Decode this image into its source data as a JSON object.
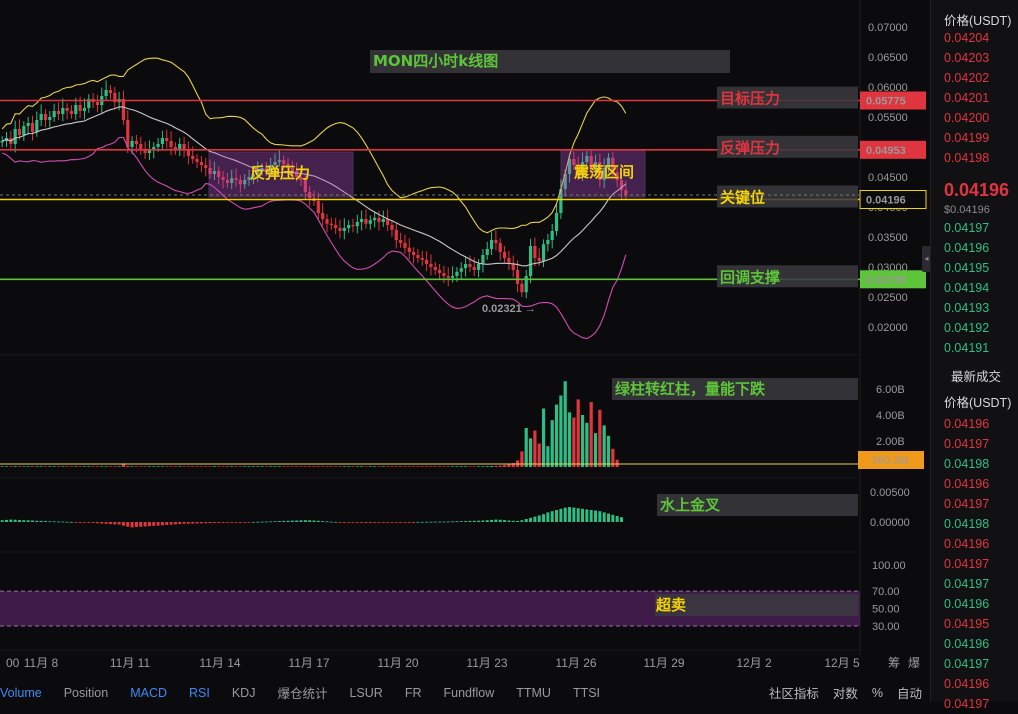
{
  "title": "MON四小时k线图",
  "price_axis": {
    "ticks": [
      "0.07000",
      "0.06500",
      "0.06000",
      "0.05500",
      "0.05000",
      "0.04500",
      "0.04000",
      "0.03500",
      "0.03000",
      "0.02500",
      "0.02000"
    ]
  },
  "volume_axis": {
    "ticks": [
      "6.00B",
      "4.00B",
      "2.00B"
    ],
    "current": "560.3M"
  },
  "macd_axis": {
    "ticks": [
      "0.00500",
      "0.00000"
    ]
  },
  "rsi_axis": {
    "ticks": [
      "100.00",
      "70.00",
      "50.00",
      "30.00"
    ]
  },
  "dates": [
    "00",
    "11月 8",
    "11月 11",
    "11月 14",
    "11月 17",
    "11月 20",
    "11月 23",
    "11月 26",
    "11月 29",
    "12月 2",
    "12月 5"
  ],
  "date_axis_icons": [
    "筹",
    "爆"
  ],
  "levels": [
    {
      "label": "目标压力",
      "price_tag": "0.05775",
      "price": 0.05775,
      "color": "#e0343f"
    },
    {
      "label": "反弹压力",
      "price_tag": "0.04953",
      "price": 0.04953,
      "color": "#e0343f"
    },
    {
      "label": "关键位",
      "price_tag": "0.04196",
      "price": 0.04125,
      "color": "#f5d300"
    },
    {
      "label": "回调支撑",
      "price_tag": "0.02795",
      "price": 0.02795,
      "color": "#5ec43a"
    }
  ],
  "boxes": [
    {
      "label": "反弹压力"
    },
    {
      "label": "震荡区间"
    }
  ],
  "low_marker": "0.02321",
  "volume_note": "绿柱转红柱，量能下跌",
  "macd_note": "水上金叉",
  "rsi_note": "超卖",
  "orderbook": {
    "header": "价格(USDT)",
    "asks": [
      "0.04204",
      "0.04203",
      "0.04202",
      "0.04201",
      "0.04200",
      "0.04199",
      "0.04198"
    ],
    "last_price": "0.04196",
    "mark_price": "$0.04196",
    "bids": [
      "0.04197",
      "0.04196",
      "0.04195",
      "0.04194",
      "0.04193",
      "0.04192",
      "0.04191"
    ],
    "trades_title": "最新成交",
    "trades_header": "价格(USDT)",
    "trades": [
      {
        "p": "0.04196",
        "side": "sell"
      },
      {
        "p": "0.04197",
        "side": "sell"
      },
      {
        "p": "0.04198",
        "side": "buy"
      },
      {
        "p": "0.04196",
        "side": "sell"
      },
      {
        "p": "0.04197",
        "side": "sell"
      },
      {
        "p": "0.04198",
        "side": "buy"
      },
      {
        "p": "0.04196",
        "side": "sell"
      },
      {
        "p": "0.04197",
        "side": "sell"
      },
      {
        "p": "0.04197",
        "side": "buy"
      },
      {
        "p": "0.04196",
        "side": "buy"
      },
      {
        "p": "0.04195",
        "side": "sell"
      },
      {
        "p": "0.04196",
        "side": "buy"
      },
      {
        "p": "0.04197",
        "side": "buy"
      },
      {
        "p": "0.04196",
        "side": "sell"
      },
      {
        "p": "0.04197",
        "side": "sell"
      }
    ]
  },
  "bottom_tabs": [
    "Volume",
    "Position",
    "MACD",
    "RSI",
    "KDJ",
    "爆仓统计",
    "LSUR",
    "FR",
    "Fundflow",
    "TTMU",
    "TTSI"
  ],
  "bottom_tabs_active": [
    "Volume",
    "MACD",
    "RSI"
  ],
  "bottom_right": [
    "社区指标",
    "对数",
    "%",
    "自动"
  ],
  "chart_data": {
    "type": "candlestick",
    "title": "MON四小时k线图",
    "x_range": [
      "11月 8",
      "11月 27"
    ],
    "y_range": [
      0.0175,
      0.0725
    ],
    "last": 0.04196,
    "low": 0.02321,
    "closes": [
      0.051,
      0.0515,
      0.0505,
      0.053,
      0.052,
      0.0535,
      0.054,
      0.0525,
      0.0545,
      0.0555,
      0.0545,
      0.055,
      0.056,
      0.0555,
      0.0565,
      0.056,
      0.0555,
      0.057,
      0.056,
      0.0565,
      0.058,
      0.0575,
      0.057,
      0.0585,
      0.0595,
      0.059,
      0.0575,
      0.058,
      0.0545,
      0.05,
      0.051,
      0.0505,
      0.0495,
      0.049,
      0.0495,
      0.05,
      0.0505,
      0.0515,
      0.051,
      0.05,
      0.0495,
      0.0505,
      0.0495,
      0.0485,
      0.048,
      0.0475,
      0.047,
      0.0465,
      0.0455,
      0.046,
      0.045,
      0.0445,
      0.044,
      0.0448,
      0.0445,
      0.0438,
      0.0445,
      0.045,
      0.0455,
      0.046,
      0.0465,
      0.0462,
      0.047,
      0.0475,
      0.0478,
      0.0472,
      0.0465,
      0.046,
      0.045,
      0.0445,
      0.0425,
      0.0415,
      0.041,
      0.039,
      0.038,
      0.0372,
      0.037,
      0.0365,
      0.036,
      0.0365,
      0.037,
      0.0368,
      0.0375,
      0.038,
      0.0372,
      0.0378,
      0.0382,
      0.0375,
      0.038,
      0.037,
      0.0362,
      0.0345,
      0.034,
      0.0332,
      0.0325,
      0.032,
      0.0315,
      0.0312,
      0.0305,
      0.03,
      0.0295,
      0.029,
      0.0285,
      0.0282,
      0.0285,
      0.0292,
      0.0298,
      0.0305,
      0.03,
      0.0295,
      0.0305,
      0.032,
      0.033,
      0.0345,
      0.034,
      0.0325,
      0.0315,
      0.0305,
      0.0295,
      0.0272,
      0.0258,
      0.0285,
      0.0335,
      0.0315,
      0.031,
      0.0338,
      0.0345,
      0.036,
      0.039,
      0.043,
      0.0455,
      0.048,
      0.047,
      0.0455,
      0.0475,
      0.0485,
      0.0462,
      0.0475,
      0.0445,
      0.0465,
      0.0482,
      0.0458,
      0.0445,
      0.0428,
      0.042
    ],
    "volume_series_B": [
      0.05,
      0.05,
      0.05,
      0.06,
      0.05,
      0.05,
      0.05,
      0.06,
      0.05,
      0.05,
      0.05,
      0.05,
      0.05,
      0.05,
      0.05,
      0.05,
      0.05,
      0.05,
      0.05,
      0.05,
      0.05,
      0.05,
      0.05,
      0.05,
      0.05,
      0.05,
      0.05,
      0.05,
      0.28,
      0.08,
      0.05,
      0.05,
      0.05,
      0.05,
      0.05,
      0.05,
      0.05,
      0.05,
      0.05,
      0.05,
      0.05,
      0.05,
      0.05,
      0.05,
      0.05,
      0.05,
      0.05,
      0.05,
      0.05,
      0.05,
      0.05,
      0.05,
      0.05,
      0.05,
      0.05,
      0.05,
      0.05,
      0.05,
      0.05,
      0.05,
      0.05,
      0.05,
      0.05,
      0.05,
      0.05,
      0.05,
      0.05,
      0.05,
      0.05,
      0.05,
      0.05,
      0.05,
      0.05,
      0.05,
      0.05,
      0.05,
      0.05,
      0.05,
      0.05,
      0.05,
      0.05,
      0.05,
      0.05,
      0.05,
      0.05,
      0.05,
      0.05,
      0.05,
      0.05,
      0.05,
      0.05,
      0.05,
      0.05,
      0.05,
      0.05,
      0.05,
      0.05,
      0.05,
      0.05,
      0.05,
      0.05,
      0.05,
      0.05,
      0.05,
      0.05,
      0.05,
      0.05,
      0.05,
      0.05,
      0.05,
      0.05,
      0.05,
      0.06,
      0.07,
      0.08,
      0.1,
      0.15,
      0.2,
      0.3,
      0.5,
      1.2,
      3.0,
      2.2,
      2.8,
      1.8,
      4.5,
      1.6,
      3.6,
      4.8,
      5.5,
      6.6,
      4.2,
      3.8,
      5.2,
      4.0,
      3.4,
      5.0,
      2.6,
      4.4,
      3.2,
      2.4,
      1.4,
      0.56
    ],
    "macd_hist": [
      0.0003,
      0.00035,
      0.0004,
      0.00038,
      0.00032,
      0.0003,
      0.00028,
      0.00025,
      0.0002,
      0.00018,
      0.00015,
      0.00012,
      0.0001,
      8e-05,
      6e-05,
      4e-05,
      2e-05,
      -2e-05,
      -5e-05,
      -8e-05,
      -0.00012,
      -0.00015,
      -0.0002,
      -0.00025,
      -0.0003,
      -0.00035,
      -0.0004,
      -0.00042,
      -0.0006,
      -0.0008,
      -0.0009,
      -0.00085,
      -0.0008,
      -0.00075,
      -0.0007,
      -0.00065,
      -0.0006,
      -0.00055,
      -0.0005,
      -0.00045,
      -0.0004,
      -0.00035,
      -0.0003,
      -0.00028,
      -0.00026,
      -0.00025,
      -0.00022,
      -0.0002,
      -0.00018,
      -0.00016,
      -0.00015,
      -0.00014,
      -0.00012,
      -0.0001,
      -8e-05,
      -6e-05,
      -4e-05,
      -2e-05,
      2e-05,
      4e-05,
      6e-05,
      8e-05,
      0.0001,
      0.00012,
      0.00015,
      0.00018,
      0.0002,
      0.00022,
      0.00025,
      0.00028,
      0.0003,
      0.00028,
      0.00025,
      0.0002,
      0.00015,
      0.0001,
      5e-05,
      2e-05,
      -2e-05,
      -5e-05,
      -8e-05,
      -0.0001,
      -0.00012,
      -0.00014,
      -0.00016,
      -0.00015,
      -0.00014,
      -0.00012,
      -0.0001,
      -8e-05,
      -6e-05,
      -5e-05,
      -4e-05,
      -3e-05,
      -2e-05,
      -1e-05,
      1e-05,
      2e-05,
      3e-05,
      4e-05,
      5e-05,
      6e-05,
      7e-05,
      8e-05,
      0.0001,
      0.00012,
      0.00014,
      0.00016,
      0.00018,
      0.0002,
      0.00022,
      0.00025,
      0.0003,
      0.00035,
      0.0004,
      0.00038,
      0.00032,
      0.00025,
      0.0002,
      0.00018,
      0.0003,
      0.0005,
      0.0007,
      0.0009,
      0.0011,
      0.0013,
      0.0016,
      0.0018,
      0.002,
      0.0022,
      0.0024,
      0.0025,
      0.0024,
      0.0023,
      0.0022,
      0.0021,
      0.002,
      0.0019,
      0.0018,
      0.0016,
      0.0014,
      0.0012,
      0.001,
      0.0008
    ]
  }
}
